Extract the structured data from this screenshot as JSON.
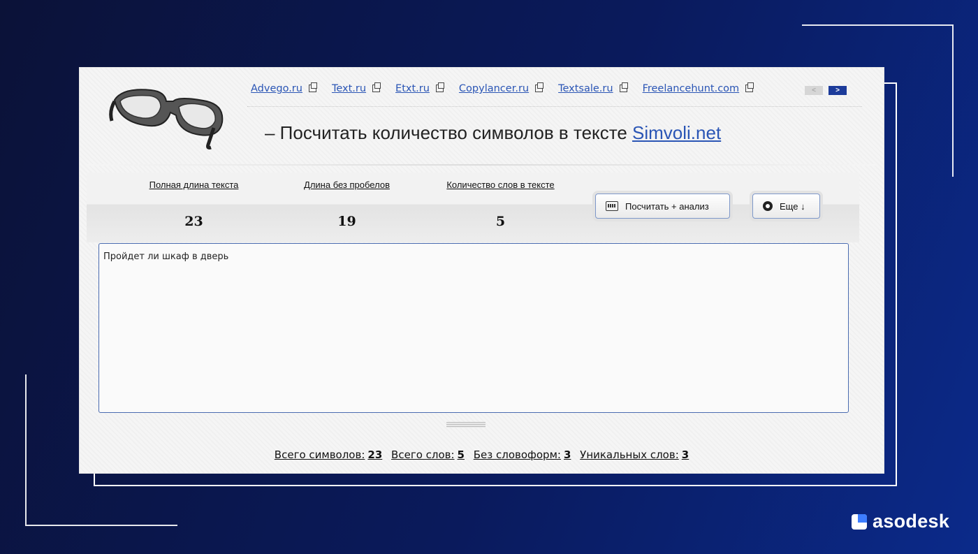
{
  "brand": {
    "name": "asodesk"
  },
  "nav": {
    "links": [
      "Advego.ru",
      "Text.ru",
      "Etxt.ru",
      "Copylancer.ru",
      "Textsale.ru",
      "Freelancehunt.com"
    ]
  },
  "header": {
    "title_text": "– Посчитать количество символов в тексте ",
    "title_link": "Simvoli.net"
  },
  "stats": {
    "full_length_label": "Полная длина текста",
    "full_length_value": "23",
    "no_spaces_label": "Длина без пробелов",
    "no_spaces_value": "19",
    "words_label": "Количество слов в тексте",
    "words_value": "5"
  },
  "buttons": {
    "calc_label": "Посчитать + анализ",
    "more_label": "Еще ↓"
  },
  "editor": {
    "value": "Пройдет ли шкаф в дверь"
  },
  "summary": {
    "total_chars_label": "Всего символов:",
    "total_chars_value": "23",
    "total_words_label": "Всего слов:",
    "total_words_value": "5",
    "no_wordforms_label": "Без словоформ:",
    "no_wordforms_value": "3",
    "unique_words_label": "Уникальных слов:",
    "unique_words_value": "3"
  },
  "colors": {
    "link": "#2a55b5",
    "background": "#0a1a5c",
    "accent": "#3d7dff"
  }
}
